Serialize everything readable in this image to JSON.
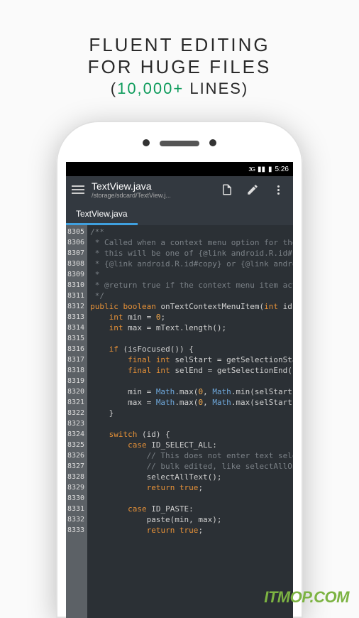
{
  "promo": {
    "line1": "FLUENT EDITING",
    "line2": "FOR HUGE FILES",
    "paren_open": "(",
    "highlight": "10,000+",
    "rest": " LINES)"
  },
  "status": {
    "network": "3G",
    "time": "5:26"
  },
  "appbar": {
    "title": "TextView.java",
    "path": "/storage/sdcard/TextView.j..."
  },
  "tab": {
    "label": "TextView.java"
  },
  "gutter_start": 8305,
  "gutter_count": 29,
  "code_lines": [
    {
      "t": "comment",
      "s": "/**"
    },
    {
      "t": "comment",
      "s": " * Called when a context menu option for the text "
    },
    {
      "t": "comment",
      "s": " * this will be one of {@link android.R.id#selectAll"
    },
    {
      "t": "comment",
      "s": " * {@link android.R.id#copy} or {@link android.R.id"
    },
    {
      "t": "comment",
      "s": " *"
    },
    {
      "t": "comment",
      "s": " * @return true if the context menu item action wa"
    },
    {
      "t": "comment",
      "s": " */"
    },
    {
      "t": "sig",
      "tokens": [
        [
          "public ",
          "keyword"
        ],
        [
          "boolean ",
          "keyword"
        ],
        [
          "onTextContextMenuItem(",
          "plain"
        ],
        [
          "int ",
          "keyword"
        ],
        [
          "id) {",
          "plain"
        ]
      ]
    },
    {
      "t": "decl",
      "tokens": [
        [
          "    ",
          "plain"
        ],
        [
          "int ",
          "keyword"
        ],
        [
          "min = ",
          "plain"
        ],
        [
          "0",
          "num"
        ],
        [
          ";",
          "plain"
        ]
      ]
    },
    {
      "t": "decl",
      "tokens": [
        [
          "    ",
          "plain"
        ],
        [
          "int ",
          "keyword"
        ],
        [
          "max = mText.length();",
          "plain"
        ]
      ]
    },
    {
      "t": "blank",
      "s": ""
    },
    {
      "t": "stmt",
      "tokens": [
        [
          "    ",
          "plain"
        ],
        [
          "if ",
          "keyword"
        ],
        [
          "(isFocused()) {",
          "plain"
        ]
      ]
    },
    {
      "t": "decl",
      "tokens": [
        [
          "        ",
          "plain"
        ],
        [
          "final int ",
          "keyword"
        ],
        [
          "selStart = getSelectionStart();",
          "plain"
        ]
      ]
    },
    {
      "t": "decl",
      "tokens": [
        [
          "        ",
          "plain"
        ],
        [
          "final int ",
          "keyword"
        ],
        [
          "selEnd = getSelectionEnd();",
          "plain"
        ]
      ]
    },
    {
      "t": "blank",
      "s": ""
    },
    {
      "t": "stmt",
      "tokens": [
        [
          "        min = ",
          "plain"
        ],
        [
          "Math",
          "class"
        ],
        [
          ".max(",
          "plain"
        ],
        [
          "0",
          "num"
        ],
        [
          ", ",
          "plain"
        ],
        [
          "Math",
          "class"
        ],
        [
          ".min(selStart, selEn",
          "plain"
        ]
      ]
    },
    {
      "t": "stmt",
      "tokens": [
        [
          "        max = ",
          "plain"
        ],
        [
          "Math",
          "class"
        ],
        [
          ".max(",
          "plain"
        ],
        [
          "0",
          "num"
        ],
        [
          ", ",
          "plain"
        ],
        [
          "Math",
          "class"
        ],
        [
          ".max(selStart, selE",
          "plain"
        ]
      ]
    },
    {
      "t": "plain",
      "s": "    }"
    },
    {
      "t": "blank",
      "s": ""
    },
    {
      "t": "stmt",
      "tokens": [
        [
          "    ",
          "plain"
        ],
        [
          "switch ",
          "keyword"
        ],
        [
          "(id) {",
          "plain"
        ]
      ]
    },
    {
      "t": "stmt",
      "tokens": [
        [
          "        ",
          "plain"
        ],
        [
          "case ",
          "keyword"
        ],
        [
          "ID_SELECT_ALL:",
          "plain"
        ]
      ]
    },
    {
      "t": "comment",
      "s": "            // This does not enter text selection mode."
    },
    {
      "t": "comment",
      "s": "            // bulk edited, like selectAllOnFocus does."
    },
    {
      "t": "plain",
      "s": "            selectAllText();"
    },
    {
      "t": "stmt",
      "tokens": [
        [
          "            ",
          "plain"
        ],
        [
          "return true",
          "ret"
        ],
        [
          ";",
          "plain"
        ]
      ]
    },
    {
      "t": "blank",
      "s": ""
    },
    {
      "t": "stmt",
      "tokens": [
        [
          "        ",
          "plain"
        ],
        [
          "case ",
          "keyword"
        ],
        [
          "ID_PASTE:",
          "plain"
        ]
      ]
    },
    {
      "t": "plain",
      "s": "            paste(min, max);"
    },
    {
      "t": "stmt",
      "tokens": [
        [
          "            ",
          "plain"
        ],
        [
          "return true",
          "ret"
        ],
        [
          ";",
          "plain"
        ]
      ]
    }
  ],
  "watermark": "ITMOP.COM"
}
